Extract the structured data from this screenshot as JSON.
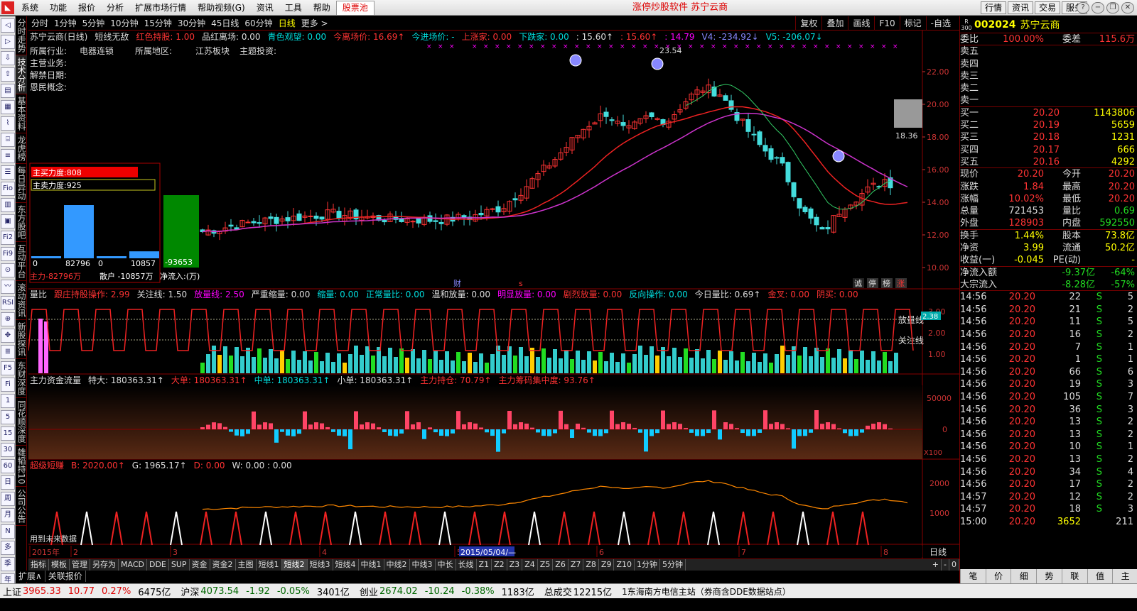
{
  "menu": {
    "items": [
      "系统",
      "功能",
      "报价",
      "分析",
      "扩展市场行情",
      "帮助视频(G)",
      "资讯",
      "工具",
      "帮助"
    ],
    "highlight": "股票池",
    "title": "涨停炒股软件   苏宁云商",
    "right_buttons": [
      "行情",
      "资讯",
      "交易",
      "服务"
    ]
  },
  "left_tabs": [
    "分时走势",
    "技术分析",
    "基本资料",
    "龙虎榜",
    "每日异动",
    "东方股吧",
    "互动平台",
    "滚动资讯",
    "新股探讯",
    "东财深度",
    "同花顺深度",
    "雄韬持10",
    "公司公告"
  ],
  "left_tools": [
    "◁",
    "▷",
    "⇩",
    "⇧",
    "▤",
    "▦",
    "⌇",
    "⌹",
    "≡",
    "☰",
    "Fio",
    "▥",
    "▣",
    "Fi2",
    "Fi9",
    "⊙",
    "〰",
    "RSI",
    "⊕",
    "✥",
    "≣",
    "F5",
    "Fi",
    "1",
    "5",
    "15",
    "30",
    "60",
    "日",
    "周",
    "月",
    "N",
    "多",
    "季",
    "年"
  ],
  "period_tabs": [
    "分时",
    "1分钟",
    "5分钟",
    "10分钟",
    "15分钟",
    "30分钟",
    "45日线",
    "60分钟",
    "日线",
    "更多 >"
  ],
  "period_active": "日线",
  "top_right_tabs": [
    "复权",
    "叠加",
    "画线",
    "F10",
    "标记",
    "-自选"
  ],
  "main": {
    "indicator_line": [
      {
        "t": "苏宁云商(日线)",
        "c": "#ddd"
      },
      {
        "t": "短线无敌",
        "c": "#ddd"
      },
      {
        "t": "红色持股: 1.00",
        "c": "#f33"
      },
      {
        "t": "品红离场: 0.00",
        "c": "#ddd"
      },
      {
        "t": "青色观望: 0.00",
        "c": "#0dd"
      },
      {
        "t": "今离场价: 16.69↑",
        "c": "#f33"
      },
      {
        "t": "今进场价: -",
        "c": "#0dd"
      },
      {
        "t": "上涨家: 0.00",
        "c": "#f33"
      },
      {
        "t": "下跌家: 0.00",
        "c": "#0dd"
      },
      {
        "t": ": 15.60↑",
        "c": "#ddd"
      },
      {
        "t": ": 15.60↑",
        "c": "#f33"
      },
      {
        "t": ": 14.79",
        "c": "#f0f"
      },
      {
        "t": "V4: -234.92↓",
        "c": "#88f"
      },
      {
        "t": "V5: -206.07↓",
        "c": "#0dd"
      }
    ],
    "info": [
      {
        "k": "所属行业:",
        "v": "电器连锁"
      },
      {
        "k": "所属地区:",
        "v": "江苏板块"
      },
      {
        "k": "主题投资:",
        "v": ""
      },
      {
        "k": "主营业务:",
        "v": ""
      },
      {
        "k": "解禁日期:",
        "v": ""
      },
      {
        "k": "恩民概念:",
        "v": ""
      }
    ],
    "peak_label": "23.54",
    "y_ticks": [
      "22.00",
      "20.00",
      "18.00",
      "16.00",
      "14.00",
      "12.00",
      "10.00"
    ],
    "price_marker": "18.36",
    "bottom_marks": [
      "财",
      "s"
    ],
    "right_marks": [
      "诚",
      "停",
      "榜",
      "涨"
    ],
    "force": {
      "buy_label": "主买力度:808",
      "sell_label": "主卖力度:925",
      "bars": [
        {
          "label": "0",
          "val": 0
        },
        {
          "label": "82796",
          "val": 82796
        },
        {
          "label": "0",
          "val": 0
        },
        {
          "label": "10857",
          "val": 10857
        }
      ],
      "big": "-93653",
      "foot_left": "主力-82796万",
      "foot_mid": "散户 -10857万",
      "foot_right": "净流入:(万)"
    }
  },
  "vol": {
    "title_items": [
      {
        "t": "量比",
        "c": "#ddd"
      },
      {
        "t": "跟庄持股操作: 2.99",
        "c": "#f33"
      },
      {
        "t": "关注线: 1.50",
        "c": "#ddd"
      },
      {
        "t": "放量线: 2.50",
        "c": "#f0f"
      },
      {
        "t": "严重缩量: 0.00",
        "c": "#ddd"
      },
      {
        "t": "缩量: 0.00",
        "c": "#0dd"
      },
      {
        "t": "正常量比: 0.00",
        "c": "#0dd"
      },
      {
        "t": "温和放量: 0.00",
        "c": "#ddd"
      },
      {
        "t": "明显放量: 0.00",
        "c": "#f0f"
      },
      {
        "t": "剧烈放量: 0.00",
        "c": "#f33"
      },
      {
        "t": "反向操作: 0.00",
        "c": "#0dd"
      },
      {
        "t": "今日量比: 0.69↑",
        "c": "#ddd"
      },
      {
        "t": "金叉: 0.00",
        "c": "#f33"
      },
      {
        "t": "阴买: 0.00",
        "c": "#f33"
      }
    ],
    "y_ticks": [
      "3.00",
      "2.00",
      "1.00"
    ],
    "lines": [
      "放量线",
      "关注线"
    ],
    "marker": "2.38"
  },
  "fund": {
    "title_items": [
      {
        "t": "主力资金流量",
        "c": "#ddd"
      },
      {
        "t": "特大: 180363.31↑",
        "c": "#ddd"
      },
      {
        "t": "大单: 180363.31↑",
        "c": "#f33"
      },
      {
        "t": "中单: 180363.31↑",
        "c": "#0dd"
      },
      {
        "t": "小单: 180363.31↑",
        "c": "#ddd"
      },
      {
        "t": "主力持仓: 70.79↑",
        "c": "#f33"
      },
      {
        "t": "主力筹码集中度: 93.76↑",
        "c": "#f33"
      }
    ],
    "y_ticks": [
      "50000",
      "0"
    ],
    "unit": "X100"
  },
  "short": {
    "title_items": [
      {
        "t": "超级短赚",
        "c": "#f33"
      },
      {
        "t": "B: 2020.00↑",
        "c": "#f33"
      },
      {
        "t": "G: 1965.17↑",
        "c": "#ddd"
      },
      {
        "t": "D: 0.00",
        "c": "#f33"
      },
      {
        "t": "W: 0.00 : 0.00",
        "c": "#ddd"
      }
    ],
    "y_ticks": [
      "2000",
      "1000"
    ],
    "foot": "用到未来数据"
  },
  "time_axis": {
    "labels": [
      "2015年",
      "2",
      "3",
      "4",
      "5",
      "6",
      "7",
      "8"
    ],
    "cursor": "2015/05/04/—",
    "mode": "日线"
  },
  "bottom_tabs": [
    "指标",
    "模板",
    "管理",
    "另存为",
    "MACD",
    "DDE",
    "SUP",
    "资金",
    "资金2",
    "主图",
    "短线1",
    "短线2",
    "短线3",
    "短线4",
    "中线1",
    "中线2",
    "中线3",
    "中长",
    "长线",
    "Z1",
    "Z2",
    "Z3",
    "Z4",
    "Z5",
    "Z6",
    "Z7",
    "Z8",
    "Z9",
    "Z10",
    "1分钟",
    "5分钟"
  ],
  "bottom_tab_active": "短线2",
  "bottom_ctrl": [
    "+",
    "-",
    "0"
  ],
  "bottom_tabs2": [
    "扩展∧",
    "关联报价"
  ],
  "quote": {
    "market": "R 300",
    "code": "002024",
    "name": "苏宁云商",
    "wei_bi": "委比",
    "wei_bi_val": "100.00%",
    "wei_cha": "委差",
    "wei_cha_val": "115.6万",
    "sell": [
      {
        "l": "卖五",
        "p": "",
        "v": ""
      },
      {
        "l": "卖四",
        "p": "",
        "v": ""
      },
      {
        "l": "卖三",
        "p": "",
        "v": ""
      },
      {
        "l": "卖二",
        "p": "",
        "v": ""
      },
      {
        "l": "卖一",
        "p": "",
        "v": ""
      }
    ],
    "buy": [
      {
        "l": "买一",
        "p": "20.20",
        "v": "1143806"
      },
      {
        "l": "买二",
        "p": "20.19",
        "v": "5659"
      },
      {
        "l": "买三",
        "p": "20.18",
        "v": "1231"
      },
      {
        "l": "买四",
        "p": "20.17",
        "v": "666"
      },
      {
        "l": "买五",
        "p": "20.16",
        "v": "4292"
      }
    ],
    "stats": [
      {
        "l1": "现价",
        "v1": "20.20",
        "c1": "c-r",
        "l2": "今开",
        "v2": "20.20",
        "c2": "c-r"
      },
      {
        "l1": "涨跌",
        "v1": "1.84",
        "c1": "c-r",
        "l2": "最高",
        "v2": "20.20",
        "c2": "c-r"
      },
      {
        "l1": "涨幅",
        "v1": "10.02%",
        "c1": "c-r",
        "l2": "最低",
        "v2": "20.20",
        "c2": "c-r"
      },
      {
        "l1": "总量",
        "v1": "721453",
        "c1": "c-w",
        "l2": "量比",
        "v2": "0.69",
        "c2": "c-g"
      },
      {
        "l1": "外盘",
        "v1": "128903",
        "c1": "c-r",
        "l2": "内盘",
        "v2": "592550",
        "c2": "c-g"
      }
    ],
    "stats2": [
      {
        "l1": "换手",
        "v1": "1.44%",
        "c1": "c-y",
        "l2": "股本",
        "v2": "73.8亿",
        "c2": "c-y"
      },
      {
        "l1": "净资",
        "v1": "3.99",
        "c1": "c-y",
        "l2": "流通",
        "v2": "50.2亿",
        "c2": "c-y"
      },
      {
        "l1": "收益(一)",
        "v1": "-0.045",
        "c1": "c-y",
        "l2": "PE(动)",
        "v2": "-",
        "c2": "c-y"
      }
    ],
    "flow": [
      {
        "l": "净流入额",
        "v": "-9.37亿",
        "p": "-64%"
      },
      {
        "l": "大宗流入",
        "v": "-8.28亿",
        "p": "-57%"
      }
    ],
    "ticks": [
      [
        "14:56",
        "20.20",
        "22",
        "S",
        "5"
      ],
      [
        "14:56",
        "20.20",
        "21",
        "S",
        "2"
      ],
      [
        "14:56",
        "20.20",
        "11",
        "S",
        "5"
      ],
      [
        "14:56",
        "20.20",
        "16",
        "S",
        "2"
      ],
      [
        "14:56",
        "20.20",
        "7",
        "S",
        "1"
      ],
      [
        "14:56",
        "20.20",
        "1",
        "S",
        "1"
      ],
      [
        "14:56",
        "20.20",
        "66",
        "S",
        "6"
      ],
      [
        "14:56",
        "20.20",
        "19",
        "S",
        "3"
      ],
      [
        "14:56",
        "20.20",
        "105",
        "S",
        "7"
      ],
      [
        "14:56",
        "20.20",
        "36",
        "S",
        "3"
      ],
      [
        "14:56",
        "20.20",
        "13",
        "S",
        "2"
      ],
      [
        "14:56",
        "20.20",
        "13",
        "S",
        "2"
      ],
      [
        "14:56",
        "20.20",
        "10",
        "S",
        "1"
      ],
      [
        "14:56",
        "20.20",
        "13",
        "S",
        "2"
      ],
      [
        "14:56",
        "20.20",
        "34",
        "S",
        "4"
      ],
      [
        "14:56",
        "20.20",
        "17",
        "S",
        "2"
      ],
      [
        "14:57",
        "20.20",
        "12",
        "S",
        "2"
      ],
      [
        "14:57",
        "20.20",
        "18",
        "S",
        "3"
      ],
      [
        "15:00",
        "20.20",
        "3652",
        "",
        "211"
      ]
    ],
    "bottom_tabs": [
      "笔",
      "价",
      "细",
      "势",
      "联",
      "值",
      "主"
    ]
  },
  "status": {
    "items": [
      {
        "l": "上证",
        "v": "3965.33",
        "c": "up"
      },
      {
        "l": "",
        "v": "10.77",
        "c": "up"
      },
      {
        "l": "",
        "v": "0.27%",
        "c": "up"
      },
      {
        "l": "",
        "v": "6475亿",
        "c": "bk"
      },
      {
        "l": "沪深",
        "v": "4073.54",
        "c": "dn"
      },
      {
        "l": "",
        "v": "-1.92",
        "c": "dn"
      },
      {
        "l": "",
        "v": "-0.05%",
        "c": "dn"
      },
      {
        "l": "",
        "v": "3401亿",
        "c": "bk"
      },
      {
        "l": "创业",
        "v": "2674.02",
        "c": "dn"
      },
      {
        "l": "",
        "v": "-10.24",
        "c": "dn"
      },
      {
        "l": "",
        "v": "-0.38%",
        "c": "dn"
      },
      {
        "l": "",
        "v": "1183亿",
        "c": "bk"
      },
      {
        "l": "总成交",
        "v": "12215亿",
        "c": "bk"
      }
    ],
    "ticker": "1东海南方电信主站（券商含DDE数据站点）"
  }
}
